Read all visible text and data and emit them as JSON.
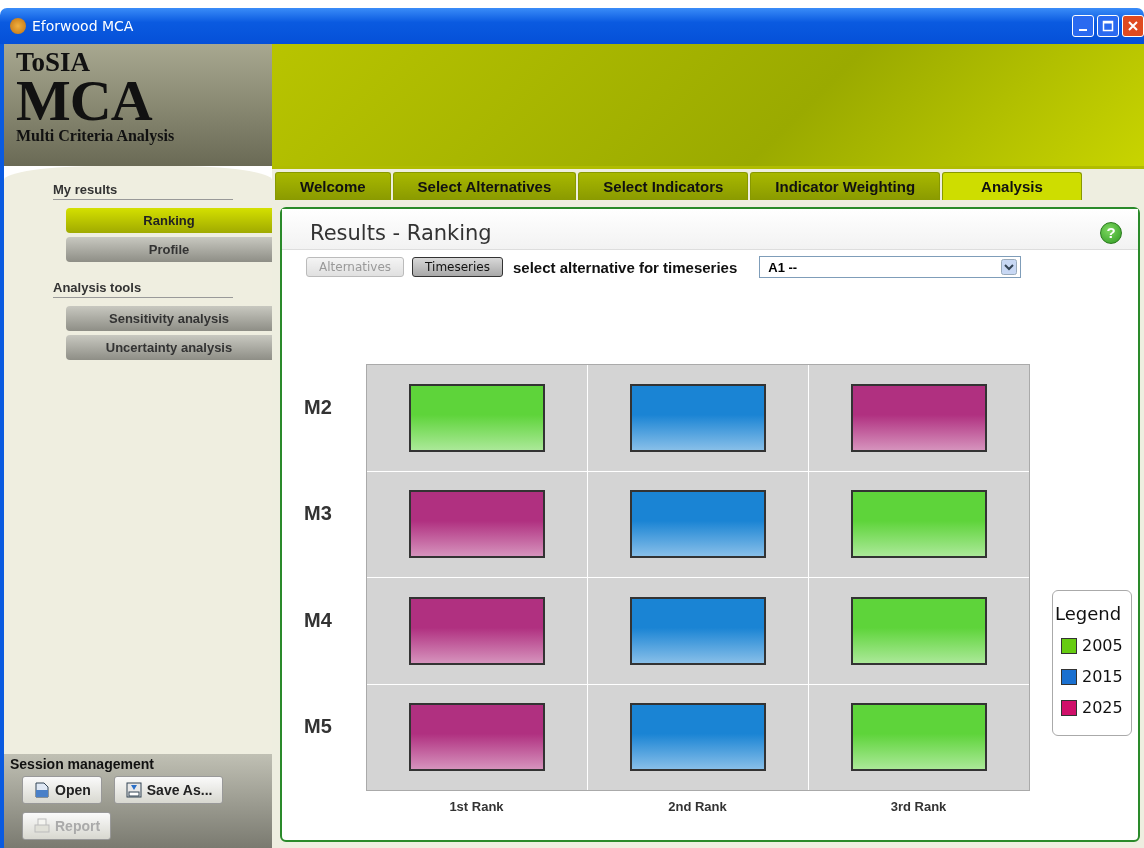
{
  "window": {
    "title": "Eforwood MCA"
  },
  "logo": {
    "line_1": "ToSIA",
    "line_2": "MCA",
    "line_3": "Multi Criteria Analysis"
  },
  "sidebar": {
    "sections": [
      {
        "title": "My results",
        "items": [
          {
            "label": "Ranking",
            "selected": true
          },
          {
            "label": "Profile",
            "selected": false
          }
        ]
      },
      {
        "title": "Analysis tools",
        "items": [
          {
            "label": "Sensitivity analysis",
            "selected": false
          },
          {
            "label": "Uncertainty analysis",
            "selected": false
          }
        ]
      }
    ],
    "session": {
      "title": "Session management",
      "buttons": [
        {
          "label": "Open",
          "kind": "open",
          "disabled": false
        },
        {
          "label": "Save As...",
          "kind": "save",
          "disabled": false
        },
        {
          "label": "Report",
          "kind": "report",
          "disabled": true
        }
      ]
    }
  },
  "tabs": [
    {
      "label": "Welcome",
      "selected": false
    },
    {
      "label": "Select Alternatives",
      "selected": false
    },
    {
      "label": "Select Indicators",
      "selected": false
    },
    {
      "label": "Indicator Weighting",
      "selected": false
    },
    {
      "label": "Analysis",
      "selected": true
    }
  ],
  "panel": {
    "title": "Results - Ranking",
    "help": "?",
    "modes": [
      {
        "label": "Alternatives",
        "selected": false
      },
      {
        "label": "Timeseries",
        "selected": true
      }
    ],
    "select_label": "select alternative for timeseries",
    "select_value": "A1 --",
    "ranking": {
      "rows": [
        {
          "label": "M2",
          "cells": [
            {
              "color": "#5ed43a"
            },
            {
              "color": "#1a84d4"
            },
            {
              "color": "#b03080"
            }
          ]
        },
        {
          "label": "M3",
          "cells": [
            {
              "color": "#b03080"
            },
            {
              "color": "#1a84d4"
            },
            {
              "color": "#5ed43a"
            }
          ]
        },
        {
          "label": "M4",
          "cells": [
            {
              "color": "#b03080"
            },
            {
              "color": "#1a84d4"
            },
            {
              "color": "#5ed43a"
            }
          ]
        },
        {
          "label": "M5",
          "cells": [
            {
              "color": "#b03080"
            },
            {
              "color": "#1a84d4"
            },
            {
              "color": "#5ed43a"
            }
          ]
        }
      ],
      "columns": [
        "1st Rank",
        "2nd Rank",
        "3rd Rank"
      ]
    },
    "legend": {
      "title": "Legend",
      "items": [
        {
          "label": "2005",
          "color": "#66cc11"
        },
        {
          "label": "2015",
          "color": "#1a70d0"
        },
        {
          "label": "2025",
          "color": "#d0106a"
        }
      ]
    }
  }
}
